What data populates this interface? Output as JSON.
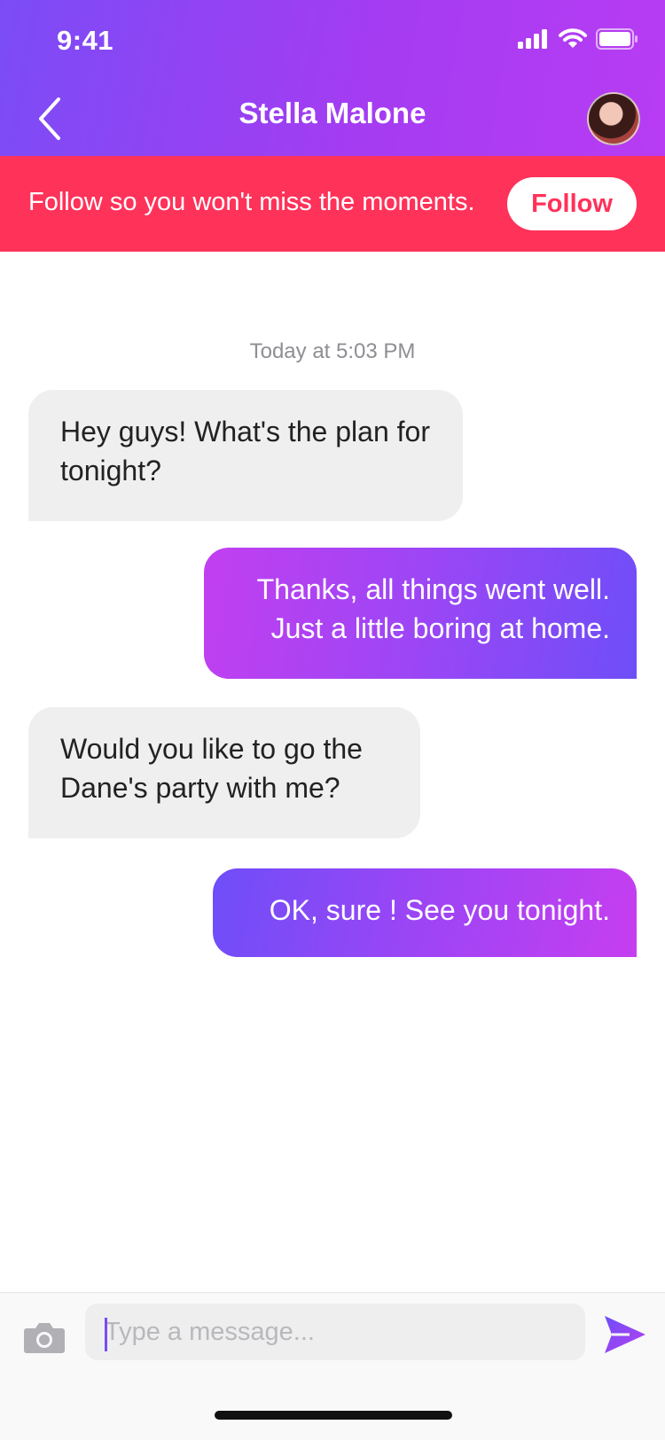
{
  "status_bar": {
    "time": "9:41"
  },
  "header": {
    "title": "Stella Malone"
  },
  "banner": {
    "text": "Follow so you won't miss the moments.",
    "button_label": "Follow"
  },
  "chat": {
    "timestamp": "Today at 5:03 PM",
    "messages": [
      {
        "direction": "incoming",
        "text": "Hey guys! What's the plan for tonight?"
      },
      {
        "direction": "outgoing",
        "text": "Thanks, all things went well. Just a little boring at home."
      },
      {
        "direction": "incoming",
        "text": "Would you like to go the Dane's party with me?"
      },
      {
        "direction": "outgoing",
        "text": "OK, sure ! See you tonight."
      }
    ]
  },
  "composer": {
    "placeholder": "Type a message...",
    "value": ""
  },
  "icons": {
    "status": [
      "signal-icon",
      "wifi-icon",
      "battery-icon"
    ],
    "header": [
      "back-chevron-icon",
      "avatar"
    ],
    "composer": [
      "camera-icon",
      "send-icon"
    ]
  },
  "colors": {
    "header_gradient_start": "#7b4cf6",
    "header_gradient_end": "#b83cf3",
    "banner": "#ff325a",
    "incoming_bubble": "#efefef",
    "accent": "#7a4cf6"
  }
}
